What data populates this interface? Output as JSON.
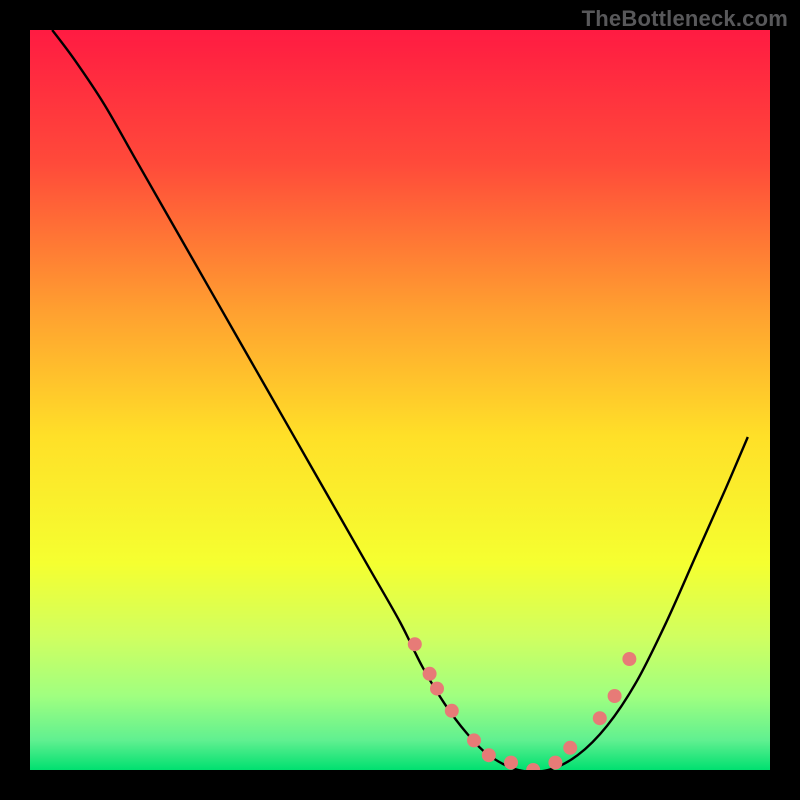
{
  "watermark": "TheBottleneck.com",
  "chart_data": {
    "type": "line",
    "title": "",
    "xlabel": "",
    "ylabel": "",
    "xlim": [
      0,
      100
    ],
    "ylim": [
      0,
      100
    ],
    "background_gradient": {
      "stops": [
        {
          "offset": 0.0,
          "color": "#ff1b42"
        },
        {
          "offset": 0.18,
          "color": "#ff4a3a"
        },
        {
          "offset": 0.38,
          "color": "#ffa030"
        },
        {
          "offset": 0.55,
          "color": "#ffe028"
        },
        {
          "offset": 0.72,
          "color": "#f5ff30"
        },
        {
          "offset": 0.82,
          "color": "#d0ff60"
        },
        {
          "offset": 0.9,
          "color": "#a0ff80"
        },
        {
          "offset": 0.96,
          "color": "#60f090"
        },
        {
          "offset": 1.0,
          "color": "#00e070"
        }
      ]
    },
    "curve": {
      "x": [
        3,
        6,
        10,
        14,
        18,
        22,
        26,
        30,
        34,
        38,
        42,
        46,
        50,
        53,
        56,
        59,
        62,
        66,
        70,
        74,
        78,
        82,
        86,
        90,
        94,
        97
      ],
      "y": [
        100,
        96,
        90,
        83,
        76,
        69,
        62,
        55,
        48,
        41,
        34,
        27,
        20,
        14,
        9,
        5,
        2,
        0,
        0,
        2,
        6,
        12,
        20,
        29,
        38,
        45
      ]
    },
    "markers": {
      "x": [
        52,
        54,
        55,
        57,
        60,
        62,
        65,
        68,
        71,
        73,
        77,
        79,
        81
      ],
      "y": [
        17,
        13,
        11,
        8,
        4,
        2,
        1,
        0,
        1,
        3,
        7,
        10,
        15
      ],
      "color": "#e77b77",
      "radius": 7
    }
  }
}
